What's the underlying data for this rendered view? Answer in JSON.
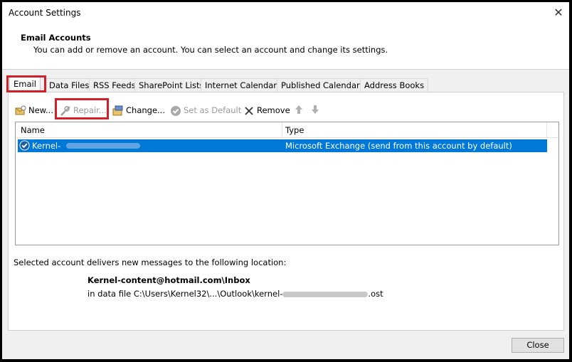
{
  "window": {
    "title": "Account Settings",
    "close_glyph": "✕"
  },
  "header": {
    "title": "Email Accounts",
    "subtitle": "You can add or remove an account. You can select an account and change its settings."
  },
  "tabs": [
    "Email",
    "Data Files",
    "RSS Feeds",
    "SharePoint Lists",
    "Internet Calendars",
    "Published Calendars",
    "Address Books"
  ],
  "toolbar": {
    "new": "New...",
    "repair": "Repair...",
    "change": "Change...",
    "set_default": "Set as Default",
    "remove": "Remove"
  },
  "list": {
    "headers": {
      "name": "Name",
      "type": "Type"
    },
    "rows": [
      {
        "name": "Kernel-",
        "type": "Microsoft Exchange (send from this account by default)"
      }
    ]
  },
  "delivery": {
    "label": "Selected account delivers new messages to the following location:",
    "account": "Kernel-content@hotmail.com\\Inbox",
    "file_prefix": "in data file C:\\Users\\Kernel32\\...\\Outlook\\kernel-",
    "file_suffix": ".ost"
  },
  "buttons": {
    "close": "Close"
  },
  "colors": {
    "selection": "#0078d7",
    "highlight_box": "#d21f2a"
  }
}
